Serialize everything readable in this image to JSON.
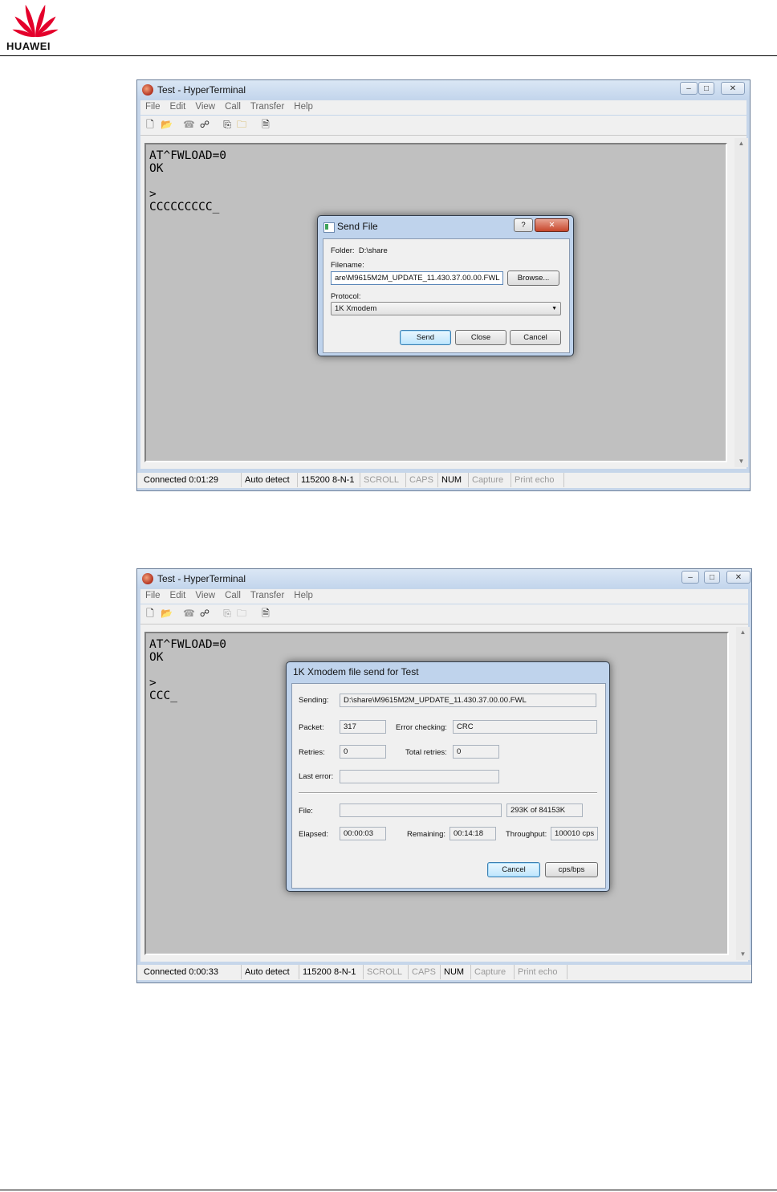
{
  "header": {
    "brand": "HUAWEI",
    "logo_icon": "huawei-petal-logo-icon",
    "brand_color": "#e4002b"
  },
  "window1": {
    "title": "Test - HyperTerminal",
    "controls": {
      "minimize": "–",
      "restore": "□",
      "close": "✕"
    },
    "menu": [
      "File",
      "Edit",
      "View",
      "Call",
      "Transfer",
      "Help"
    ],
    "terminal_lines": "AT^FWLOAD=0\nOK\n\n>\nCCCCCCCCC_",
    "status": {
      "connected": "Connected 0:01:29",
      "detect": "Auto detect",
      "settings": "115200 8-N-1",
      "scroll": "SCROLL",
      "caps": "CAPS",
      "num": "NUM",
      "capture": "Capture",
      "print_echo": "Print echo"
    }
  },
  "send_file_dialog": {
    "title": "Send File",
    "help_button": "?",
    "close_button": "✕",
    "folder_label": "Folder:",
    "folder_value": "D:\\share",
    "filename_label": "Filename:",
    "filename_value": "are\\M9615M2M_UPDATE_11.430.37.00.00.FWL",
    "browse": "Browse...",
    "protocol_label": "Protocol:",
    "protocol_value": "1K Xmodem",
    "send": "Send",
    "close": "Close",
    "cancel": "Cancel"
  },
  "window2": {
    "title": "Test - HyperTerminal",
    "controls": {
      "minimize": "–",
      "restore": "□",
      "close": "✕"
    },
    "menu": [
      "File",
      "Edit",
      "View",
      "Call",
      "Transfer",
      "Help"
    ],
    "terminal_lines": "AT^FWLOAD=0\nOK\n\n>\nCCC_",
    "status": {
      "connected": "Connected 0:00:33",
      "detect": "Auto detect",
      "settings": "115200 8-N-1",
      "scroll": "SCROLL",
      "caps": "CAPS",
      "num": "NUM",
      "capture": "Capture",
      "print_echo": "Print echo"
    }
  },
  "xmodem_dialog": {
    "title": "1K Xmodem file send for Test",
    "sending_label": "Sending:",
    "sending_value": "D:\\share\\M9615M2M_UPDATE_11.430.37.00.00.FWL",
    "packet_label": "Packet:",
    "packet_value": "317",
    "error_checking_label": "Error checking:",
    "error_checking_value": "CRC",
    "retries_label": "Retries:",
    "retries_value": "0",
    "total_retries_label": "Total retries:",
    "total_retries_value": "0",
    "last_error_label": "Last error:",
    "last_error_value": "",
    "file_label": "File:",
    "file_progress": "293K of 84153K",
    "elapsed_label": "Elapsed:",
    "elapsed_value": "00:00:03",
    "remaining_label": "Remaining:",
    "remaining_value": "00:14:18",
    "throughput_label": "Throughput:",
    "throughput_value": "100010 cps",
    "cancel": "Cancel",
    "cps_bps": "cps/bps"
  }
}
